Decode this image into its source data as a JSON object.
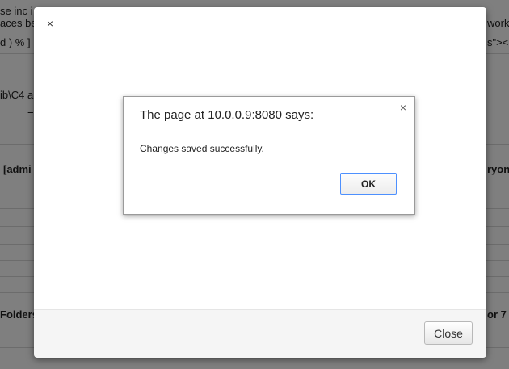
{
  "background_page": {
    "fragments": [
      "se inc i",
      "aces be",
      "d ) % ]",
      "ib\\C4 a",
      "=",
      "[admi",
      "Folders",
      "work",
      "s\"><",
      "ryon",
      "or 7"
    ]
  },
  "modal": {
    "close_icon": "×",
    "footer": {
      "close_label": "Close"
    }
  },
  "alert": {
    "title": "The page at 10.0.0.9:8080 says:",
    "close_icon": "×",
    "message": "Changes saved successfully.",
    "ok_label": "OK"
  }
}
